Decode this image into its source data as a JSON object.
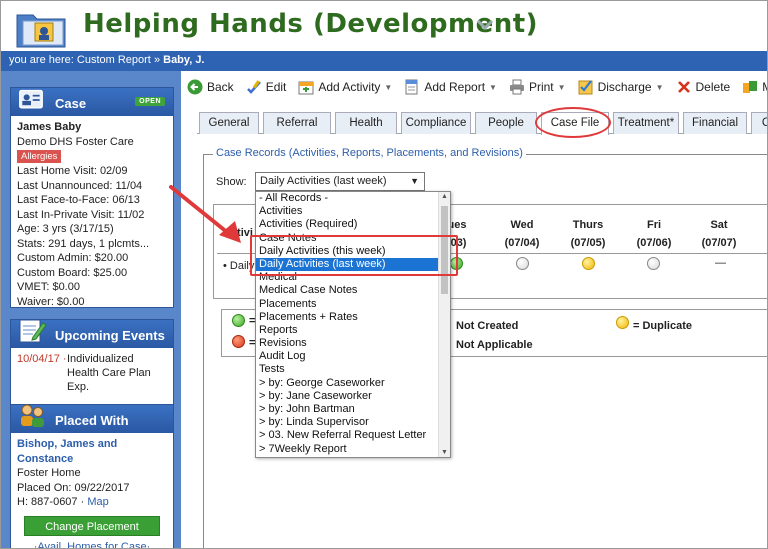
{
  "app": {
    "title": "Helping Hands (Development)"
  },
  "breadcrumb": {
    "prefix": "you are here:",
    "report": "Custom Report",
    "sep": "»",
    "current": "Baby, J."
  },
  "case_panel": {
    "title": "Case",
    "status": "OPEN",
    "name": "James Baby",
    "program": "Demo DHS Foster Care",
    "allergy": "Allergies",
    "lines": [
      "Last Home Visit: 02/09",
      "Last Unannounced: 11/04",
      "Last Face-to-Face: 06/13",
      "Last In-Private Visit: 11/02",
      "Age: 3 yrs (3/17/15)",
      "Stats: 291 days, 1 plcmts...",
      "Custom Admin: $20.00",
      "Custom Board: $25.00",
      "VMET: $0.00",
      "Waiver: $0.00"
    ]
  },
  "events_panel": {
    "title": "Upcoming Events",
    "date": "10/04/17",
    "dot": "·",
    "text_lines": [
      "Individualized",
      "Health Care Plan",
      "Exp."
    ]
  },
  "placed_panel": {
    "title": "Placed With",
    "name_line1": "Bishop, James and",
    "name_line2": "Constance",
    "type": "Foster Home",
    "placed_on": "Placed On: 09/22/2017",
    "phone": "H: 887-0607 ·",
    "map": "Map",
    "change_button": "Change Placement",
    "homes_link": "Avail. Homes for Case"
  },
  "toolbar": {
    "back": "Back",
    "edit": "Edit",
    "add_activity": "Add Activity",
    "add_report": "Add Report",
    "print": "Print",
    "discharge": "Discharge",
    "delete": "Delete",
    "more": "M"
  },
  "tabs": [
    "General",
    "Referral",
    "Health",
    "Compliance",
    "People",
    "Case File",
    "Treatment*",
    "Financial",
    "C"
  ],
  "active_tab": "Case File",
  "section": {
    "legend": "Case Records (Activities, Reports, Placements, and Revisions)",
    "show_label": "Show:",
    "selected": "Daily Activities (last week)"
  },
  "grid": {
    "activity_header": "Activi",
    "row_label": "• Daily",
    "days": [
      {
        "name": "ues",
        "date": "/03)"
      },
      {
        "name": "Wed",
        "date": "(07/04)"
      },
      {
        "name": "Thurs",
        "date": "(07/05)"
      },
      {
        "name": "Fri",
        "date": "(07/06)"
      },
      {
        "name": "Sat",
        "date": "(07/07)"
      }
    ],
    "row_statuses": [
      "green",
      "gray",
      "yellow",
      "gray",
      "dash"
    ],
    "dash": "—"
  },
  "legend_items": {
    "not_created": "Not Created",
    "duplicate": "= Duplicate",
    "not_applicable": "Not Applicable",
    "eq": "="
  },
  "dropdown": {
    "options": [
      "- All Records -",
      "Activities",
      "Activities (Required)",
      "Case Notes",
      "Daily Activities (this week)",
      "Daily Activities (last week)",
      "Medical",
      "Medical Case Notes",
      "Placements",
      "Placements + Rates",
      "Reports",
      "Revisions",
      "Audit Log",
      "Tests",
      "> by: George Caseworker",
      "> by: Jane Caseworker",
      "> by: John Bartman",
      "> by: Linda Supervisor",
      "> 03. New Referral Request Letter",
      "> 7Weekly Report"
    ],
    "selected_index": 5
  },
  "colors": {
    "title_green": "#2f6b1f",
    "blue": "#2e62b2",
    "annotation_red": "#e0393a",
    "selection": "#1b74d3"
  }
}
